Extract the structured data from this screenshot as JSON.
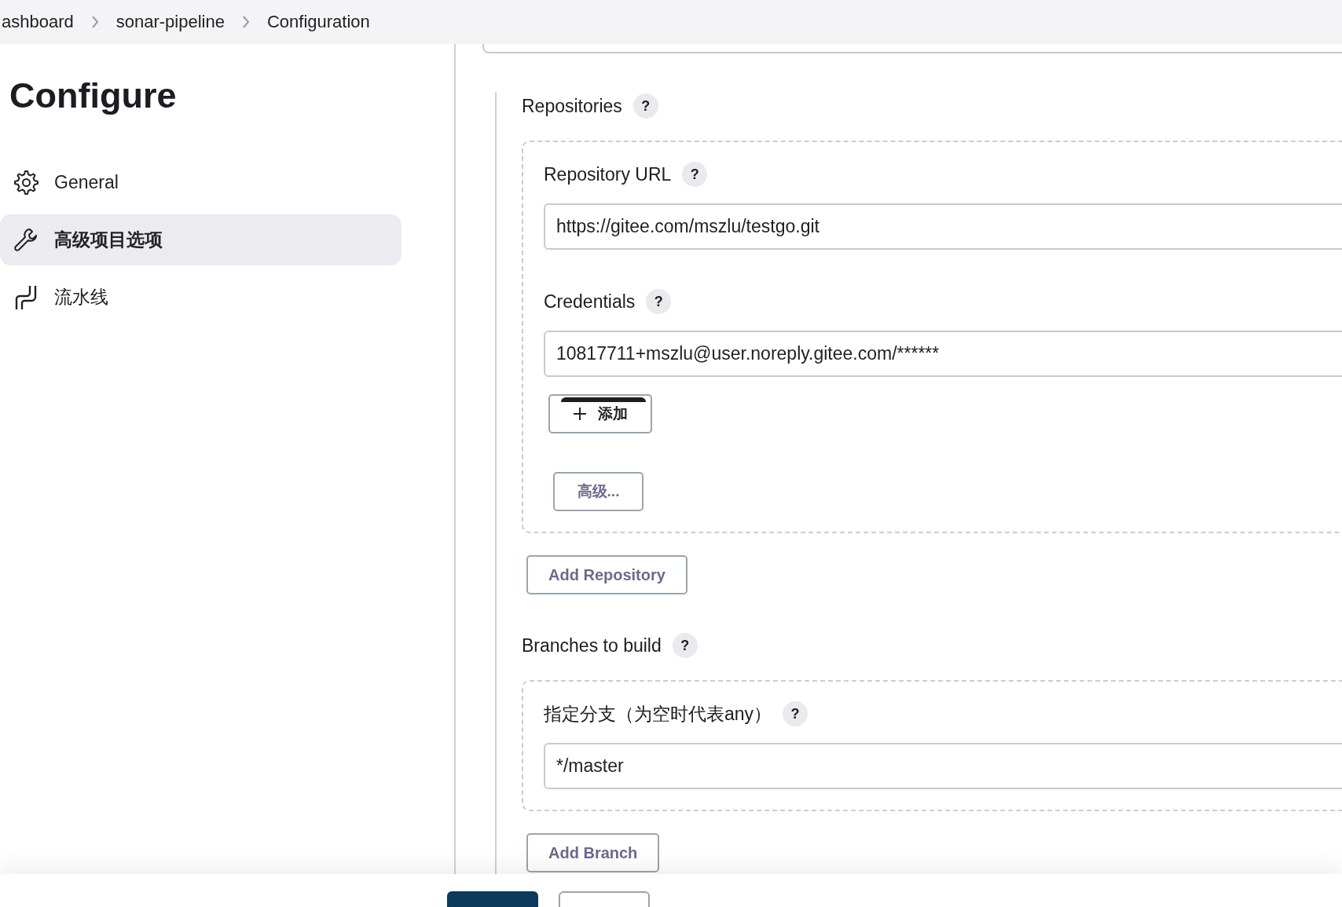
{
  "breadcrumbs": [
    {
      "label": "ashboard"
    },
    {
      "label": "sonar-pipeline"
    },
    {
      "label": "Configuration"
    }
  ],
  "page_title": "Configure",
  "sidebar": {
    "items": [
      {
        "label": "General",
        "selected": false
      },
      {
        "label": "高级项目选项",
        "selected": true
      },
      {
        "label": "流水线",
        "selected": false
      }
    ]
  },
  "repositories": {
    "label": "Repositories",
    "help": "?",
    "entries": [
      {
        "fields": [
          {
            "label": "Repository URL",
            "help": "?",
            "value": "https://gitee.com/mszlu/testgo.git"
          },
          {
            "label": "Credentials",
            "help": "?",
            "value": "10817711+mszlu@user.noreply.gitee.com/******",
            "add_button": "添加"
          }
        ],
        "advanced_button": "高级..."
      }
    ],
    "add_button": "Add Repository"
  },
  "branches": {
    "label": "Branches to build",
    "help": "?",
    "entries": [
      {
        "label": "指定分支（为空时代表any）",
        "help": "?",
        "value": "*/master"
      }
    ],
    "add_button": "Add Branch"
  },
  "footer": {
    "buttons": [
      {
        "kind": "primary"
      },
      {
        "kind": "secondary"
      }
    ]
  }
}
